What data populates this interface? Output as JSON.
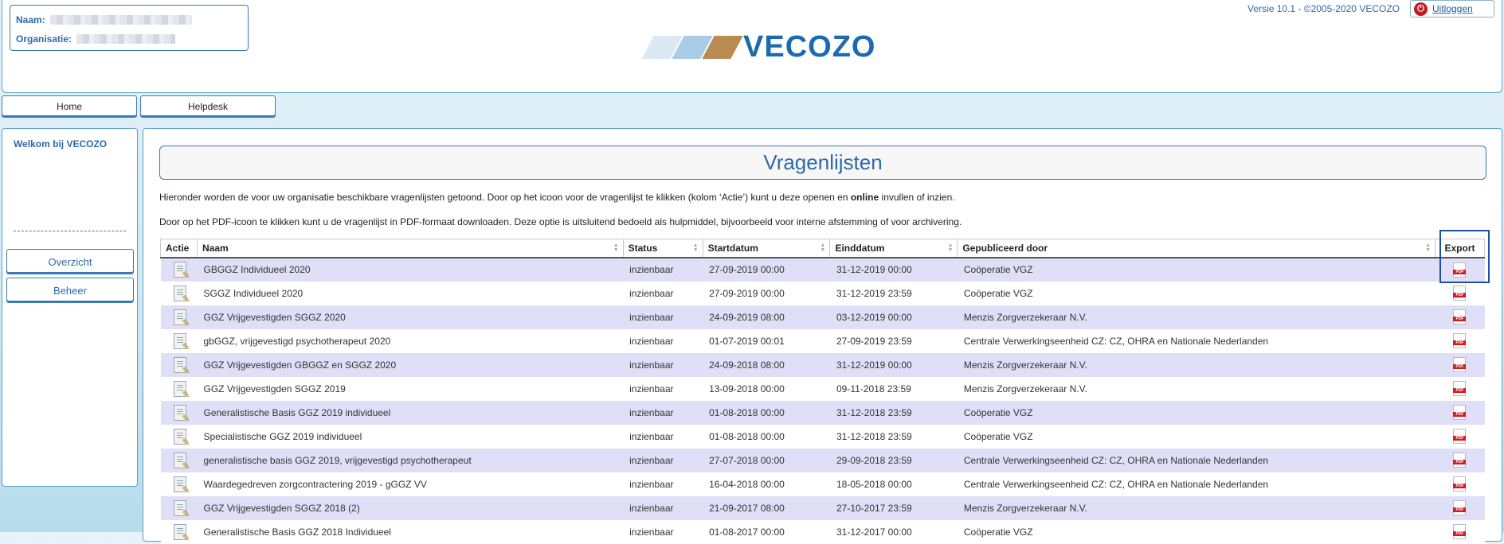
{
  "header": {
    "user_label": "Naam:",
    "org_label": "Organisatie:",
    "logo_text": "VECOZO",
    "version": "Versie 10.1 - ©2005-2020 VECOZO",
    "logout": "Uitloggen"
  },
  "nav": {
    "home": "Home",
    "helpdesk": "Helpdesk"
  },
  "sidebar": {
    "welcome": "Welkom bij VECOZO",
    "items": [
      {
        "label": "Overzicht"
      },
      {
        "label": "Beheer"
      }
    ]
  },
  "main": {
    "title": "Vragenlijsten",
    "intro1_a": "Hieronder worden de voor uw organisatie beschikbare vragenlijsten getoond. Door op het icoon voor de vragenlijst te klikken (kolom ‘Actie’) kunt u deze openen en ",
    "intro1_b": "online",
    "intro1_c": " invullen of inzien.",
    "intro2": "Door op het PDF-icoon te klikken kunt u de vragenlijst in PDF-formaat downloaden. Deze optie is uitsluitend bedoeld als hulpmiddel, bijvoorbeeld voor interne afstemming of voor archivering.",
    "columns": [
      "Actie",
      "Naam",
      "Status",
      "Startdatum",
      "Einddatum",
      "Gepubliceerd door",
      "Export"
    ],
    "rows": [
      {
        "naam": "GBGGZ Individueel 2020",
        "status": "inzienbaar",
        "start": "27-09-2019 00:00",
        "eind": "31-12-2019 00:00",
        "door": "Coöperatie VGZ"
      },
      {
        "naam": "SGGZ Individueel 2020",
        "status": "inzienbaar",
        "start": "27-09-2019 00:00",
        "eind": "31-12-2019 23:59",
        "door": "Coöperatie VGZ"
      },
      {
        "naam": "GGZ Vrijgevestigden SGGZ 2020",
        "status": "inzienbaar",
        "start": "24-09-2019 08:00",
        "eind": "03-12-2019 00:00",
        "door": "Menzis Zorgverzekeraar N.V."
      },
      {
        "naam": "gbGGZ, vrijgevestigd psychotherapeut 2020",
        "status": "inzienbaar",
        "start": "01-07-2019 00:01",
        "eind": "27-09-2019 23:59",
        "door": "Centrale Verwerkingseenheid CZ: CZ, OHRA en Nationale Nederlanden"
      },
      {
        "naam": "GGZ Vrijgevestigden GBGGZ en SGGZ 2020",
        "status": "inzienbaar",
        "start": "24-09-2018 08:00",
        "eind": "31-12-2019 00:00",
        "door": "Menzis Zorgverzekeraar N.V."
      },
      {
        "naam": "GGZ Vrijgevestigden SGGZ 2019",
        "status": "inzienbaar",
        "start": "13-09-2018 00:00",
        "eind": "09-11-2018 23:59",
        "door": "Menzis Zorgverzekeraar N.V."
      },
      {
        "naam": "Generalistische Basis GGZ 2019 individueel",
        "status": "inzienbaar",
        "start": "01-08-2018 00:00",
        "eind": "31-12-2018 23:59",
        "door": "Coöperatie VGZ"
      },
      {
        "naam": "Specialistische GGZ 2019 individueel",
        "status": "inzienbaar",
        "start": "01-08-2018 00:00",
        "eind": "31-12-2018 23:59",
        "door": "Coöperatie VGZ"
      },
      {
        "naam": "generalistische basis GGZ 2019, vrijgevestigd psychotherapeut",
        "status": "inzienbaar",
        "start": "27-07-2018 00:00",
        "eind": "29-09-2018 23:59",
        "door": "Centrale Verwerkingseenheid CZ: CZ, OHRA en Nationale Nederlanden"
      },
      {
        "naam": "Waardegedreven zorgcontractering 2019 - gGGZ VV",
        "status": "inzienbaar",
        "start": "16-04-2018 00:00",
        "eind": "18-05-2018 00:00",
        "door": "Centrale Verwerkingseenheid CZ: CZ, OHRA en Nationale Nederlanden"
      },
      {
        "naam": "GGZ Vrijgevestigden SGGZ 2018 (2)",
        "status": "inzienbaar",
        "start": "21-09-2017 08:00",
        "eind": "27-10-2017 23:59",
        "door": "Menzis Zorgverzekeraar N.V."
      },
      {
        "naam": "Generalistische Basis GGZ 2018 Individueel",
        "status": "inzienbaar",
        "start": "01-08-2017 00:00",
        "eind": "31-12-2017 00:00",
        "door": "Coöperatie VGZ"
      }
    ]
  },
  "colors": {
    "accent": "#2e6aa8",
    "border": "#3b79b5",
    "row_alt": "#dfdff8",
    "pdf": "#d8181f"
  },
  "icons": {
    "action": "edit-document-icon",
    "export": "pdf-icon",
    "logout": "power-icon"
  }
}
